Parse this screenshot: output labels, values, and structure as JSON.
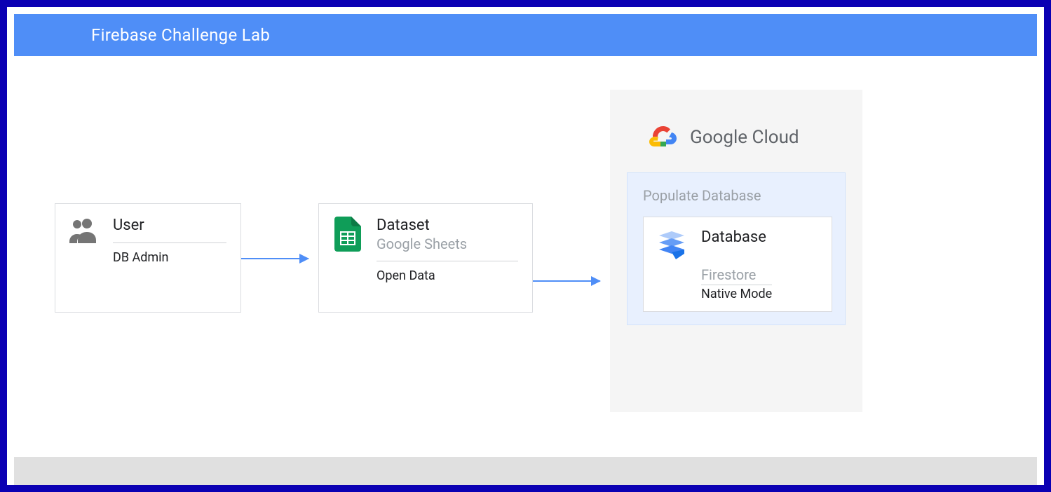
{
  "title": "Firebase Challenge Lab",
  "user": {
    "title": "User",
    "sub": "DB Admin"
  },
  "dataset": {
    "title": "Dataset",
    "subtitle": "Google Sheets",
    "sub": "Open Data"
  },
  "cloud": {
    "title": "Google Cloud",
    "populate": "Populate Database",
    "db": {
      "title": "Database",
      "subtitle": "Firestore",
      "sub": "Native Mode"
    }
  }
}
